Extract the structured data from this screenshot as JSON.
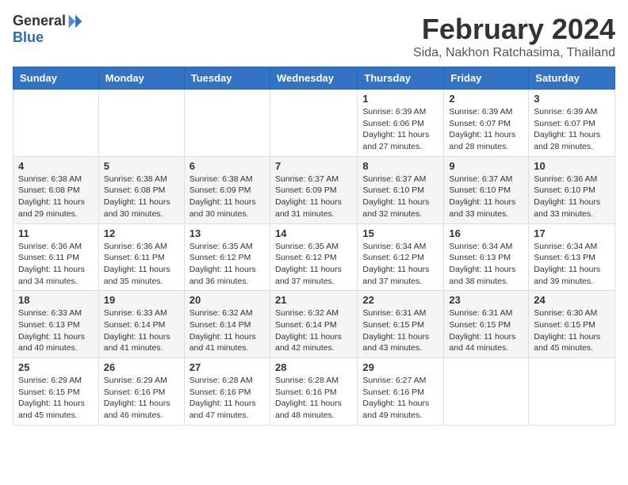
{
  "logo": {
    "general": "General",
    "blue": "Blue"
  },
  "title": "February 2024",
  "location": "Sida, Nakhon Ratchasima, Thailand",
  "weekdays": [
    "Sunday",
    "Monday",
    "Tuesday",
    "Wednesday",
    "Thursday",
    "Friday",
    "Saturday"
  ],
  "weeks": [
    [
      {
        "day": "",
        "info": ""
      },
      {
        "day": "",
        "info": ""
      },
      {
        "day": "",
        "info": ""
      },
      {
        "day": "",
        "info": ""
      },
      {
        "day": "1",
        "info": "Sunrise: 6:39 AM\nSunset: 6:06 PM\nDaylight: 11 hours\nand 27 minutes."
      },
      {
        "day": "2",
        "info": "Sunrise: 6:39 AM\nSunset: 6:07 PM\nDaylight: 11 hours\nand 28 minutes."
      },
      {
        "day": "3",
        "info": "Sunrise: 6:39 AM\nSunset: 6:07 PM\nDaylight: 11 hours\nand 28 minutes."
      }
    ],
    [
      {
        "day": "4",
        "info": "Sunrise: 6:38 AM\nSunset: 6:08 PM\nDaylight: 11 hours\nand 29 minutes."
      },
      {
        "day": "5",
        "info": "Sunrise: 6:38 AM\nSunset: 6:08 PM\nDaylight: 11 hours\nand 30 minutes."
      },
      {
        "day": "6",
        "info": "Sunrise: 6:38 AM\nSunset: 6:09 PM\nDaylight: 11 hours\nand 30 minutes."
      },
      {
        "day": "7",
        "info": "Sunrise: 6:37 AM\nSunset: 6:09 PM\nDaylight: 11 hours\nand 31 minutes."
      },
      {
        "day": "8",
        "info": "Sunrise: 6:37 AM\nSunset: 6:10 PM\nDaylight: 11 hours\nand 32 minutes."
      },
      {
        "day": "9",
        "info": "Sunrise: 6:37 AM\nSunset: 6:10 PM\nDaylight: 11 hours\nand 33 minutes."
      },
      {
        "day": "10",
        "info": "Sunrise: 6:36 AM\nSunset: 6:10 PM\nDaylight: 11 hours\nand 33 minutes."
      }
    ],
    [
      {
        "day": "11",
        "info": "Sunrise: 6:36 AM\nSunset: 6:11 PM\nDaylight: 11 hours\nand 34 minutes."
      },
      {
        "day": "12",
        "info": "Sunrise: 6:36 AM\nSunset: 6:11 PM\nDaylight: 11 hours\nand 35 minutes."
      },
      {
        "day": "13",
        "info": "Sunrise: 6:35 AM\nSunset: 6:12 PM\nDaylight: 11 hours\nand 36 minutes."
      },
      {
        "day": "14",
        "info": "Sunrise: 6:35 AM\nSunset: 6:12 PM\nDaylight: 11 hours\nand 37 minutes."
      },
      {
        "day": "15",
        "info": "Sunrise: 6:34 AM\nSunset: 6:12 PM\nDaylight: 11 hours\nand 37 minutes."
      },
      {
        "day": "16",
        "info": "Sunrise: 6:34 AM\nSunset: 6:13 PM\nDaylight: 11 hours\nand 38 minutes."
      },
      {
        "day": "17",
        "info": "Sunrise: 6:34 AM\nSunset: 6:13 PM\nDaylight: 11 hours\nand 39 minutes."
      }
    ],
    [
      {
        "day": "18",
        "info": "Sunrise: 6:33 AM\nSunset: 6:13 PM\nDaylight: 11 hours\nand 40 minutes."
      },
      {
        "day": "19",
        "info": "Sunrise: 6:33 AM\nSunset: 6:14 PM\nDaylight: 11 hours\nand 41 minutes."
      },
      {
        "day": "20",
        "info": "Sunrise: 6:32 AM\nSunset: 6:14 PM\nDaylight: 11 hours\nand 41 minutes."
      },
      {
        "day": "21",
        "info": "Sunrise: 6:32 AM\nSunset: 6:14 PM\nDaylight: 11 hours\nand 42 minutes."
      },
      {
        "day": "22",
        "info": "Sunrise: 6:31 AM\nSunset: 6:15 PM\nDaylight: 11 hours\nand 43 minutes."
      },
      {
        "day": "23",
        "info": "Sunrise: 6:31 AM\nSunset: 6:15 PM\nDaylight: 11 hours\nand 44 minutes."
      },
      {
        "day": "24",
        "info": "Sunrise: 6:30 AM\nSunset: 6:15 PM\nDaylight: 11 hours\nand 45 minutes."
      }
    ],
    [
      {
        "day": "25",
        "info": "Sunrise: 6:29 AM\nSunset: 6:15 PM\nDaylight: 11 hours\nand 45 minutes."
      },
      {
        "day": "26",
        "info": "Sunrise: 6:29 AM\nSunset: 6:16 PM\nDaylight: 11 hours\nand 46 minutes."
      },
      {
        "day": "27",
        "info": "Sunrise: 6:28 AM\nSunset: 6:16 PM\nDaylight: 11 hours\nand 47 minutes."
      },
      {
        "day": "28",
        "info": "Sunrise: 6:28 AM\nSunset: 6:16 PM\nDaylight: 11 hours\nand 48 minutes."
      },
      {
        "day": "29",
        "info": "Sunrise: 6:27 AM\nSunset: 6:16 PM\nDaylight: 11 hours\nand 49 minutes."
      },
      {
        "day": "",
        "info": ""
      },
      {
        "day": "",
        "info": ""
      }
    ]
  ]
}
